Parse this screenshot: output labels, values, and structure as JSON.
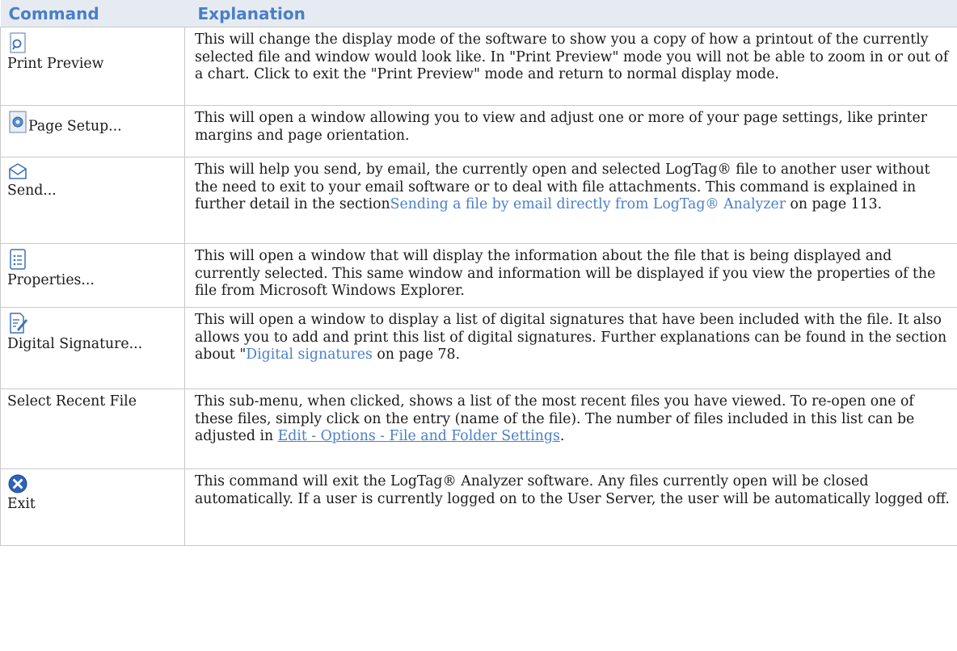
{
  "header": {
    "command": "Command",
    "explanation": "Explanation"
  },
  "rows": [
    {
      "label": "Print Preview",
      "icon": "print-preview-icon",
      "text": "This will change the display mode of the software to show you a copy of how a printout of the currently selected file and window would look like. In \"Print Preview\" mode you will not be able to zoom in or out of a chart. Click to exit the \"Print Preview\" mode and return to normal display mode."
    },
    {
      "label": "Page Setup...",
      "icon": "page-setup-icon",
      "text": "This will open a window allowing you to view and adjust one or more of your page settings, like printer margins and page orientation."
    },
    {
      "label": "Send...",
      "icon": "envelope-icon",
      "text_a": "This will help you send, by email, the currently open and selected LogTag® file to another user without the need to exit to your email software or to deal with file attachments. This command is explained in further detail in the section",
      "link": "Sending a file by email directly from LogTag® Analyzer",
      "text_b": " on page 113."
    },
    {
      "label": "Properties...",
      "icon": "properties-icon",
      "text": "This will open a window that will display the information about the file that is being displayed and currently selected. This same window and information will be displayed if you view the properties of the file from Microsoft Windows Explorer."
    },
    {
      "label": "Digital Signature...",
      "icon": "digital-signature-icon",
      "text_a": "This will open a window to display a list of digital signatures that have been included with the file. It also allows you to add and print this list of digital signatures. Further explanations can be found in the section about \"",
      "link": "Digital signatures ",
      "text_b": " on page 78."
    },
    {
      "label": "Select Recent File",
      "text_a": "This sub-menu, when clicked, shows a list of the most recent files you have viewed. To re-open one of these files, simply click on the entry (name of the file). The number of files included in this list can be adjusted in ",
      "link": "Edit - Options - File and Folder Settings",
      "text_b": "."
    },
    {
      "label": "Exit",
      "icon": "exit-icon",
      "text": "This command will exit the LogTag® Analyzer software. Any files currently open will be closed automatically. If a user is currently logged on to the User Server, the user will be automatically logged off."
    }
  ]
}
